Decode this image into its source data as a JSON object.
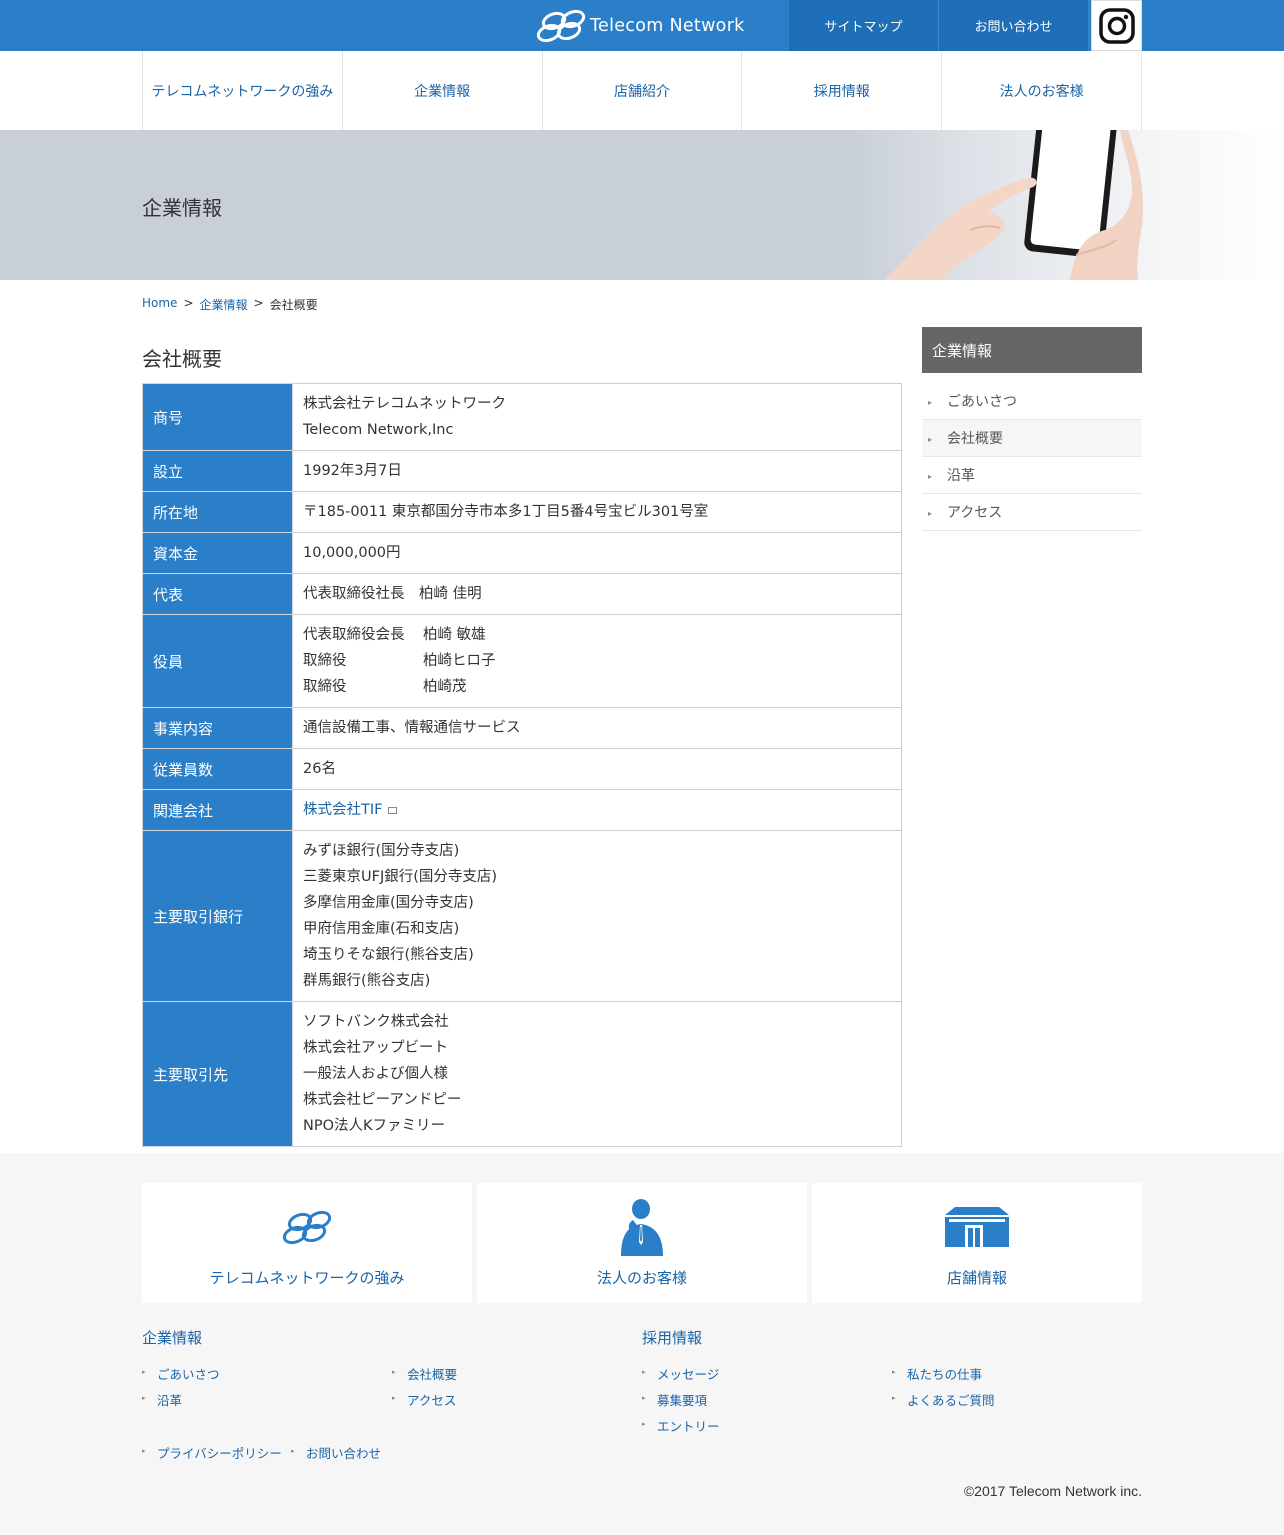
{
  "header": {
    "logo_text": "Telecom Network",
    "sitemap_label": "サイトマップ",
    "contact_label": "お問い合わせ",
    "brand_color": "#2a7fc8",
    "instagram_icon": "instagram-icon"
  },
  "nav": {
    "items": [
      {
        "label": "テレコムネットワークの強み"
      },
      {
        "label": "企業情報"
      },
      {
        "label": "店舗紹介"
      },
      {
        "label": "採用情報"
      },
      {
        "label": "法人のお客様"
      }
    ]
  },
  "hero": {
    "title": "企業情報"
  },
  "breadcrumb": {
    "home": "Home",
    "sep1": ">",
    "parent": "企業情報",
    "sep2": ">",
    "current": "会社概要"
  },
  "page": {
    "section_title": "会社概要"
  },
  "company_table": {
    "rows": [
      {
        "label": "商号",
        "lines": [
          "株式会社テレコムネットワーク",
          "Telecom Network,Inc"
        ]
      },
      {
        "label": "設立",
        "lines": [
          "1992年3月7日"
        ]
      },
      {
        "label": "所在地",
        "lines": [
          "〒185-0011 東京都国分寺市本多1丁目5番4号宝ビル301号室"
        ]
      },
      {
        "label": "資本金",
        "lines": [
          "10,000,000円"
        ]
      },
      {
        "label": "代表",
        "lines": [
          "代表取締役社長　柏崎 佳明"
        ]
      },
      {
        "label": "役員",
        "officers": [
          {
            "title": "代表取締役会長",
            "name": "柏崎 敏雄"
          },
          {
            "title": "取締役",
            "name": "柏崎ヒロ子"
          },
          {
            "title": "取締役",
            "name": "柏崎茂"
          }
        ]
      },
      {
        "label": "事業内容",
        "lines": [
          "通信設備工事、情報通信サービス"
        ]
      },
      {
        "label": "従業員数",
        "lines": [
          "26名"
        ]
      },
      {
        "label": "関連会社",
        "link": "株式会社TIF"
      },
      {
        "label": "主要取引銀行",
        "lines": [
          "みずほ銀行(国分寺支店)",
          "三菱東京UFJ銀行(国分寺支店)",
          "多摩信用金庫(国分寺支店)",
          "甲府信用金庫(石和支店)",
          "埼玉りそな銀行(熊谷支店)",
          "群馬銀行(熊谷支店)"
        ]
      },
      {
        "label": "主要取引先",
        "lines": [
          "ソフトバンク株式会社",
          "株式会社アップビート",
          "一般法人および個人様",
          "株式会社ピーアンドピー",
          "NPO法人Kファミリー"
        ]
      }
    ]
  },
  "sidebar": {
    "heading": "企業情報",
    "items": [
      {
        "label": "ごあいさつ"
      },
      {
        "label": "会社概要"
      },
      {
        "label": "沿革"
      },
      {
        "label": "アクセス"
      }
    ]
  },
  "footer": {
    "cards": [
      {
        "label": "テレコムネットワークの強み",
        "icon": "logo-rings-icon"
      },
      {
        "label": "法人のお客様",
        "icon": "businessman-icon"
      },
      {
        "label": "店舗情報",
        "icon": "store-icon"
      }
    ],
    "company_title": "企業情報",
    "company_links": [
      "ごあいさつ",
      "会社概要",
      "沿革",
      "アクセス"
    ],
    "recruit_title": "採用情報",
    "recruit_links": [
      "メッセージ",
      "私たちの仕事",
      "募集要項",
      "よくあるご質問",
      "エントリー"
    ],
    "bottom_links": [
      "プライバシーポリシー",
      "お問い合わせ"
    ],
    "copyright": "©2017 Telecom Network inc."
  }
}
